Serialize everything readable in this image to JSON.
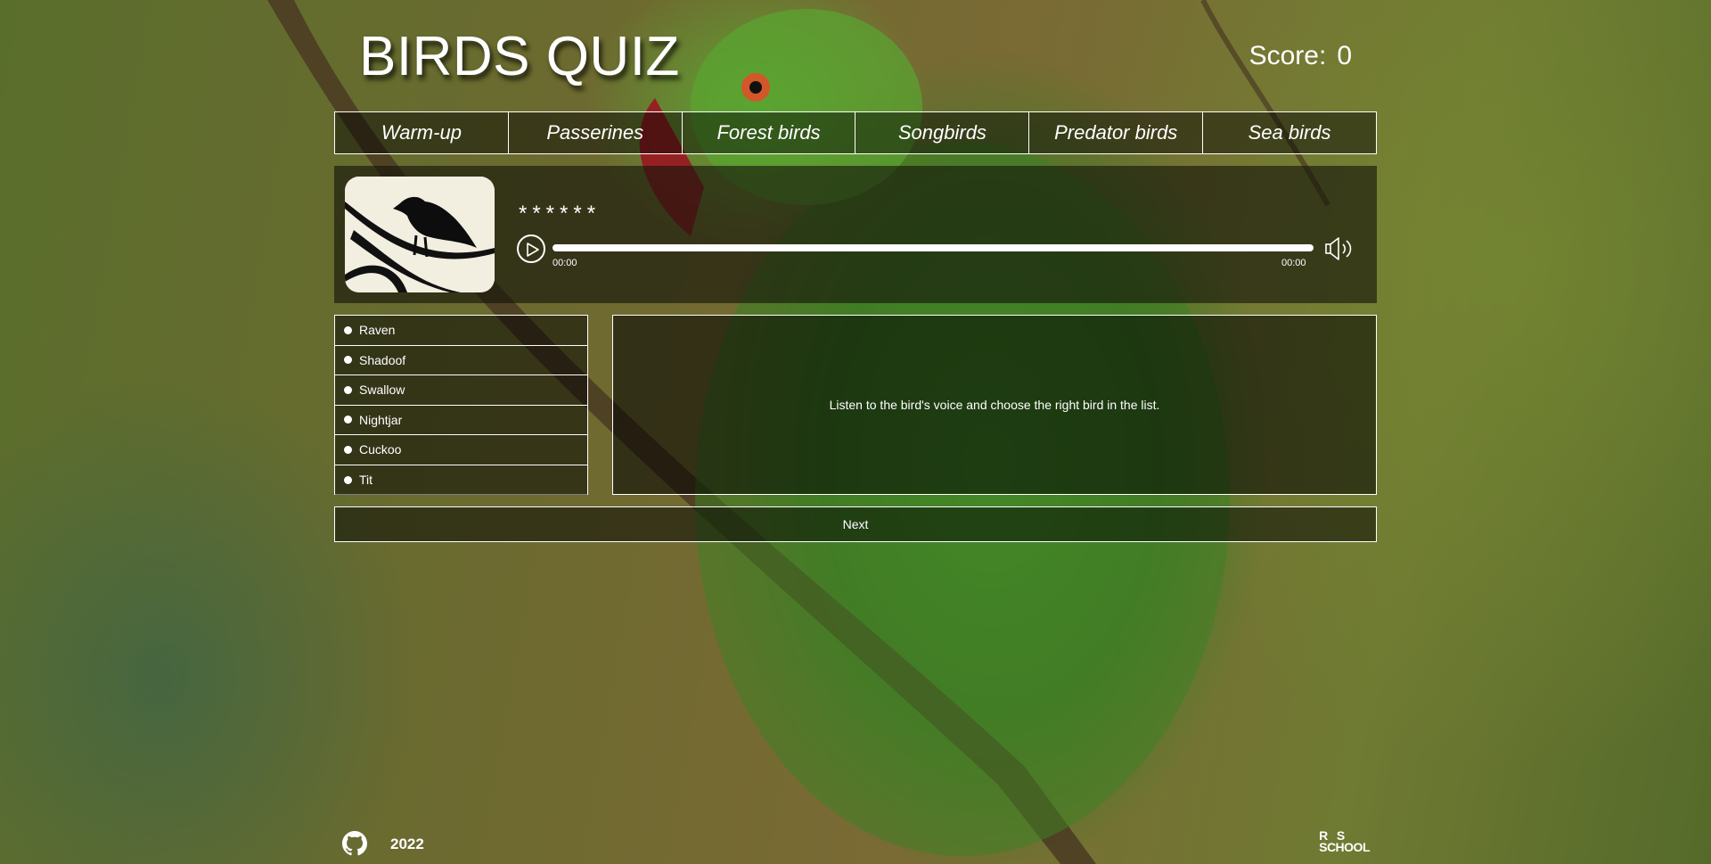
{
  "header": {
    "title": "BIRDS QUIZ",
    "score_label": "Score:",
    "score_value": "0"
  },
  "nav": {
    "items": [
      "Warm-up",
      "Passerines",
      "Forest birds",
      "Songbirds",
      "Predator birds",
      "Sea birds"
    ]
  },
  "question": {
    "hidden_name": "******",
    "player": {
      "current_time": "00:00",
      "total_time": "00:00",
      "progress": 0
    }
  },
  "answers": [
    "Raven",
    "Shadoof",
    "Swallow",
    "Nightjar",
    "Cuckoo",
    "Tit"
  ],
  "info": {
    "message": "Listen to the bird's voice and choose the right bird in the list."
  },
  "next_button": "Next",
  "footer": {
    "year": "2022",
    "school_logo": "RS SCHOOL"
  },
  "icons": {
    "play": "play-icon",
    "volume": "volume-icon",
    "github": "github-icon"
  }
}
